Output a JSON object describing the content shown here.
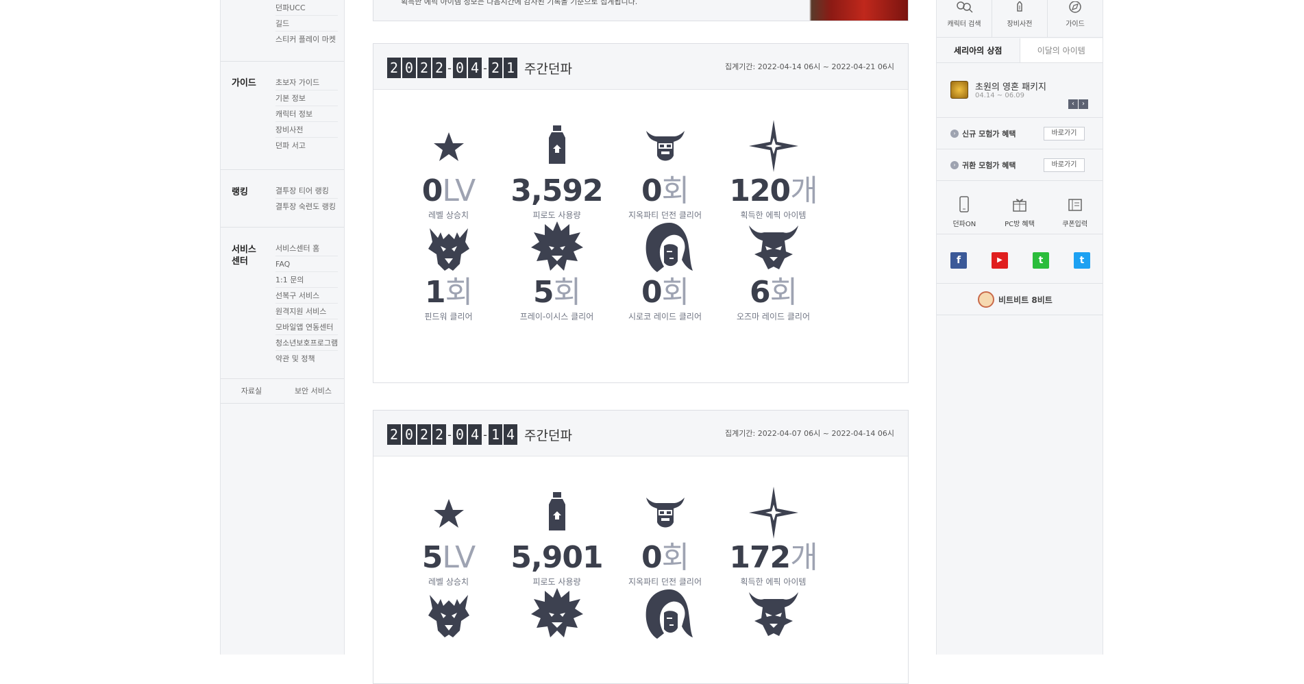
{
  "left_nav": {
    "top_items": [
      "던파UCC",
      "길드",
      "스티커 플레이 마켓"
    ],
    "guide": {
      "title": "가이드",
      "items": [
        "초보자 가이드",
        "기본 정보",
        "캐릭터 정보",
        "장비사전",
        "던파 서고"
      ]
    },
    "ranking": {
      "title": "랭킹",
      "items": [
        "결투장 티어 랭킹",
        "결투장 숙련도 랭킹"
      ]
    },
    "service": {
      "title_line1": "서비스",
      "title_line2": "센터",
      "items": [
        "서비스센터 홈",
        "FAQ",
        "1:1 문의",
        "선복구 서비스",
        "원격지원 서비스",
        "모바일앱 연동센터",
        "청소년보호프로그램",
        "약관 및 정책"
      ]
    },
    "bottom": [
      "자료실",
      "보안 서비스"
    ]
  },
  "banner": {
    "text": "획득한 에픽 아이템 정보는 다음시간에 감사된 기록을 기준으로 집계됩니다."
  },
  "weeks": [
    {
      "date_digits": [
        "2",
        "0",
        "2",
        "2",
        "-",
        "0",
        "4",
        "-",
        "2",
        "1"
      ],
      "title": "주간던파",
      "period": "집계기간: 2022-04-14 06시 ~ 2022-04-21 06시",
      "stats": [
        {
          "icon": "star-icon",
          "value": "0",
          "unit": "LV",
          "label": "레벨 상승치"
        },
        {
          "icon": "potion-icon",
          "value": "3,592",
          "unit": "",
          "label": "피로도 사용량"
        },
        {
          "icon": "demon-helmet-icon",
          "value": "0",
          "unit": "회",
          "label": "지옥파티 던전 클리어"
        },
        {
          "icon": "sparkle-icon",
          "value": "120",
          "unit": "개",
          "label": "획득한 에픽 아이템"
        },
        {
          "icon": "dragon-icon",
          "value": "1",
          "unit": "회",
          "label": "핀드워 클리어"
        },
        {
          "icon": "spiky-beast-icon",
          "value": "5",
          "unit": "회",
          "label": "프레이-이시스 클리어"
        },
        {
          "icon": "long-hair-face-icon",
          "value": "0",
          "unit": "회",
          "label": "시로코 레이드 클리어"
        },
        {
          "icon": "horned-mask-icon",
          "value": "6",
          "unit": "회",
          "label": "오즈마 레이드 클리어"
        }
      ]
    },
    {
      "date_digits": [
        "2",
        "0",
        "2",
        "2",
        "-",
        "0",
        "4",
        "-",
        "1",
        "4"
      ],
      "title": "주간던파",
      "period": "집계기간: 2022-04-07 06시 ~ 2022-04-14 06시",
      "stats": [
        {
          "icon": "star-icon",
          "value": "5",
          "unit": "LV",
          "label": "레벨 상승치"
        },
        {
          "icon": "potion-icon",
          "value": "5,901",
          "unit": "",
          "label": "피로도 사용량"
        },
        {
          "icon": "demon-helmet-icon",
          "value": "0",
          "unit": "회",
          "label": "지옥파티 던전 클리어"
        },
        {
          "icon": "sparkle-icon",
          "value": "172",
          "unit": "개",
          "label": "획득한 에픽 아이템"
        },
        {
          "icon": "dragon-icon",
          "value": "",
          "unit": "",
          "label": ""
        },
        {
          "icon": "spiky-beast-icon",
          "value": "",
          "unit": "",
          "label": ""
        },
        {
          "icon": "long-hair-face-icon",
          "value": "",
          "unit": "",
          "label": ""
        },
        {
          "icon": "horned-mask-icon",
          "value": "",
          "unit": "",
          "label": ""
        }
      ]
    }
  ],
  "right_bar": {
    "quick_menu": [
      "캐릭터 검색",
      "장비사전",
      "가이드"
    ],
    "tabs": [
      "세리아의 상점",
      "이달의 아이템"
    ],
    "package": {
      "title": "초원의 영혼 패키지",
      "date": "04.14 ~ 06.09",
      "prev": "‹",
      "next": "›"
    },
    "benefits": [
      {
        "label": "신규 모험가 혜택",
        "button": "바로가기"
      },
      {
        "label": "귀환 모험가 혜택",
        "button": "바로가기"
      }
    ],
    "services": [
      "던파ON",
      "PC방 혜택",
      "쿠폰입력"
    ],
    "social": {
      "facebook": "f",
      "youtube": "▶",
      "kakao": "t",
      "twitter": "t"
    },
    "bitbit": "비트비트 8비트",
    "colors": {
      "facebook": "#3b5998",
      "youtube": "#e01f1f",
      "kakao": "#2bbd3c",
      "twitter": "#1da1f2"
    }
  }
}
